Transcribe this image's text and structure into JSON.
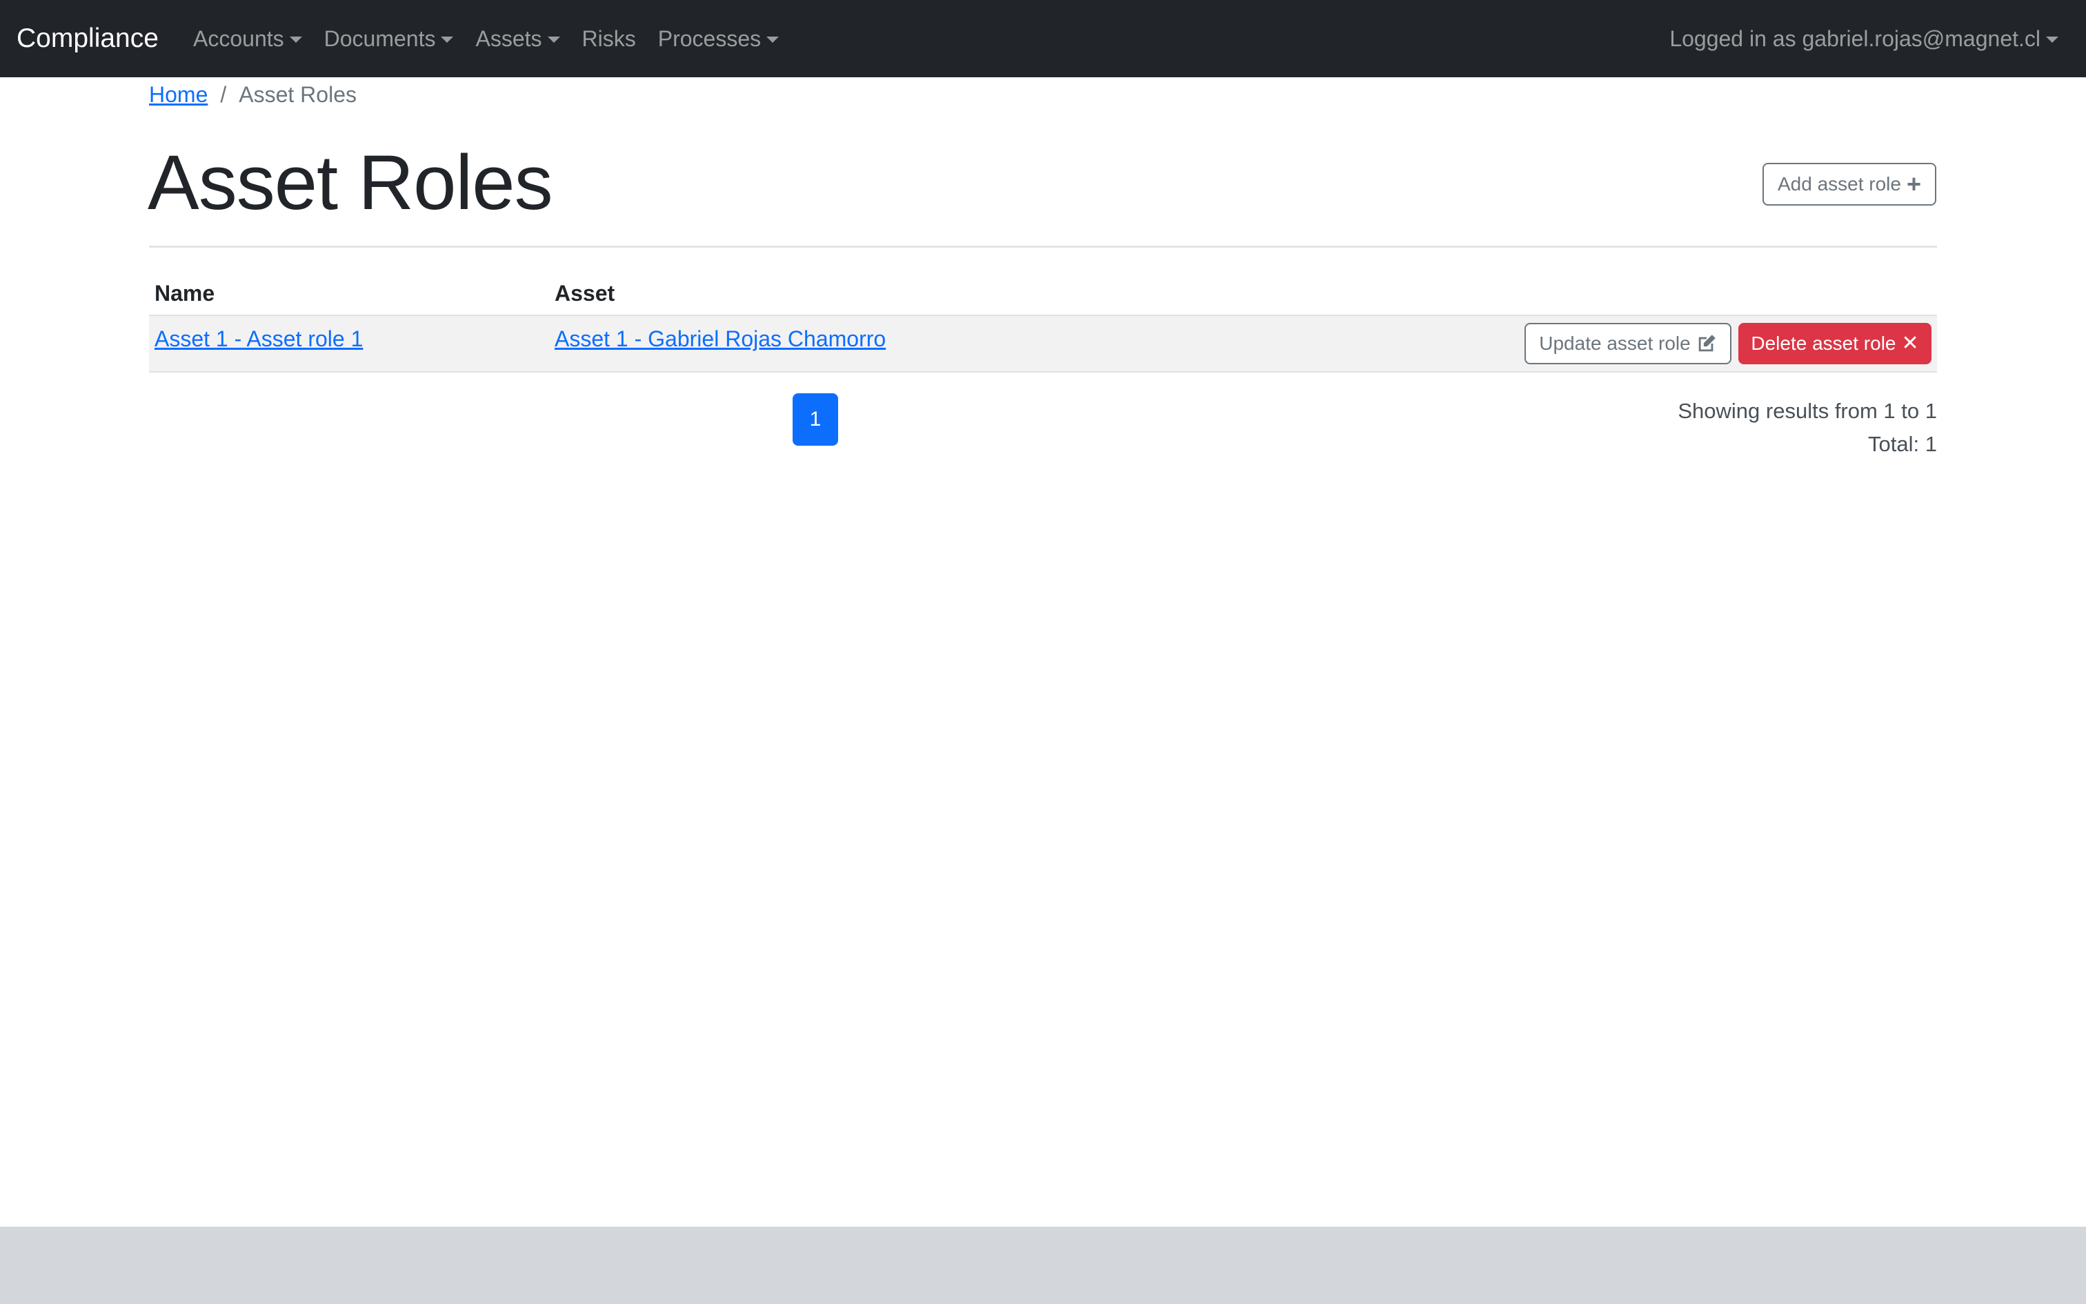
{
  "navbar": {
    "brand": "Compliance",
    "items": [
      {
        "label": "Accounts",
        "dropdown": true
      },
      {
        "label": "Documents",
        "dropdown": true
      },
      {
        "label": "Assets",
        "dropdown": true
      },
      {
        "label": "Risks",
        "dropdown": false
      },
      {
        "label": "Processes",
        "dropdown": true
      }
    ],
    "user_label": "Logged in as gabriel.rojas@magnet.cl"
  },
  "breadcrumb": {
    "home": "Home",
    "separator": "/",
    "current": "Asset Roles"
  },
  "page": {
    "title": "Asset Roles",
    "add_button_label": "Add asset role",
    "add_button_icon": "plus-icon"
  },
  "table": {
    "columns": [
      "Name",
      "Asset"
    ],
    "rows": [
      {
        "name": "Asset 1 - Asset role 1",
        "asset": "Asset 1 - Gabriel Rojas Chamorro",
        "update_label": "Update asset role",
        "delete_label": "Delete asset role"
      }
    ]
  },
  "pagination": {
    "current_page": "1"
  },
  "results": {
    "showing": "Showing results from 1 to 1",
    "total": "Total: 1"
  },
  "colors": {
    "navbar_bg": "#212529",
    "link": "#0d6efd",
    "danger": "#dc3545",
    "primary": "#0d6efd",
    "footer_bg": "#d3d7db"
  }
}
